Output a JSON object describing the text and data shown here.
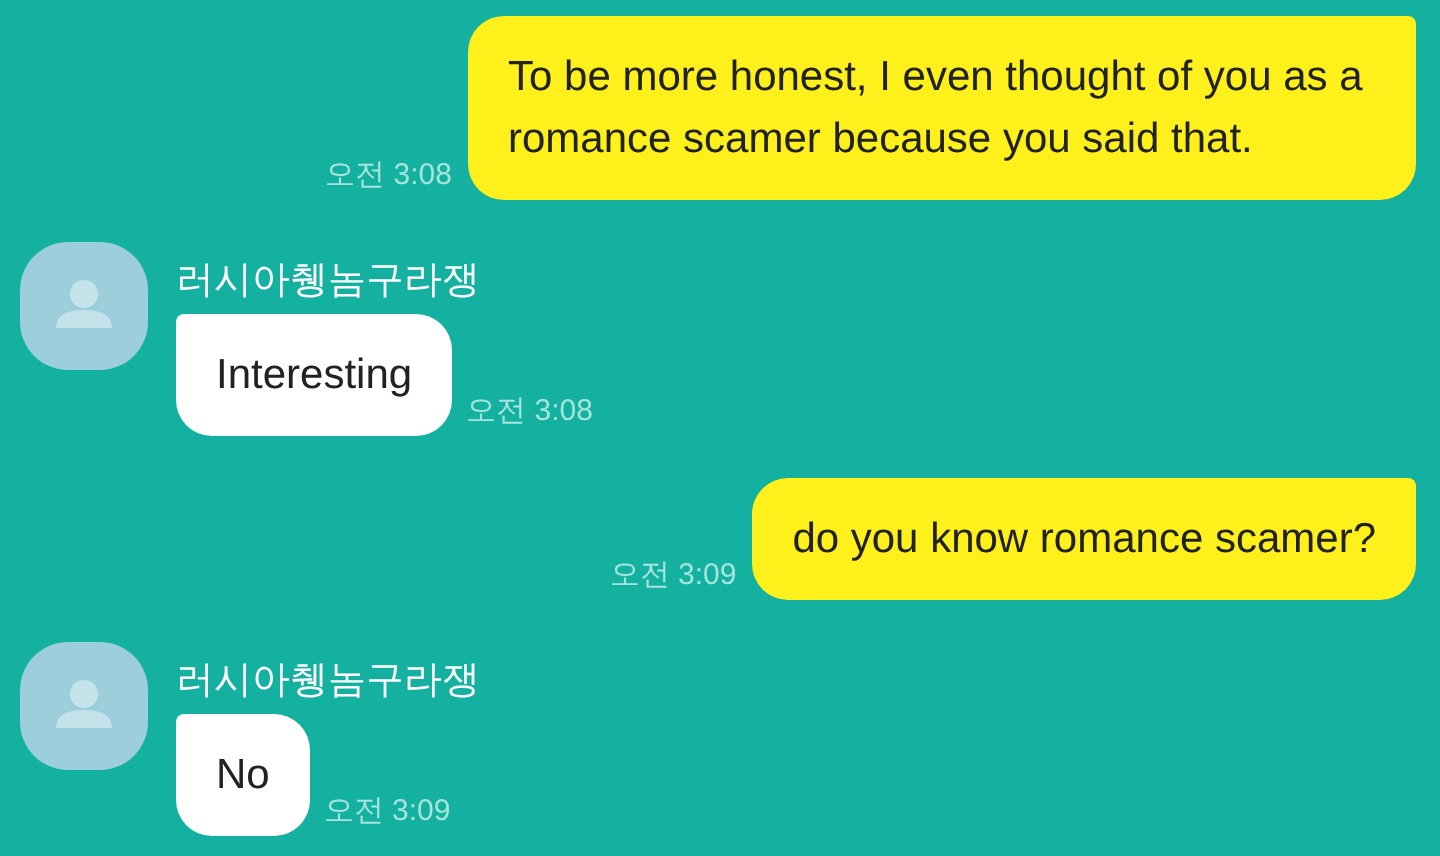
{
  "messages": [
    {
      "kind": "sent",
      "text": "To be more honest, I even thought of you as a romance scamer because you said that.",
      "time": "오전 3:08"
    },
    {
      "kind": "received",
      "sender": "러시아췡놈구라쟁",
      "text": "Interesting",
      "time": "오전 3:08"
    },
    {
      "kind": "sent",
      "text": "do you know romance scamer?",
      "time": "오전 3:09"
    },
    {
      "kind": "received",
      "sender": "러시아췡놈구라쟁",
      "text": "No",
      "time": "오전 3:09"
    }
  ]
}
